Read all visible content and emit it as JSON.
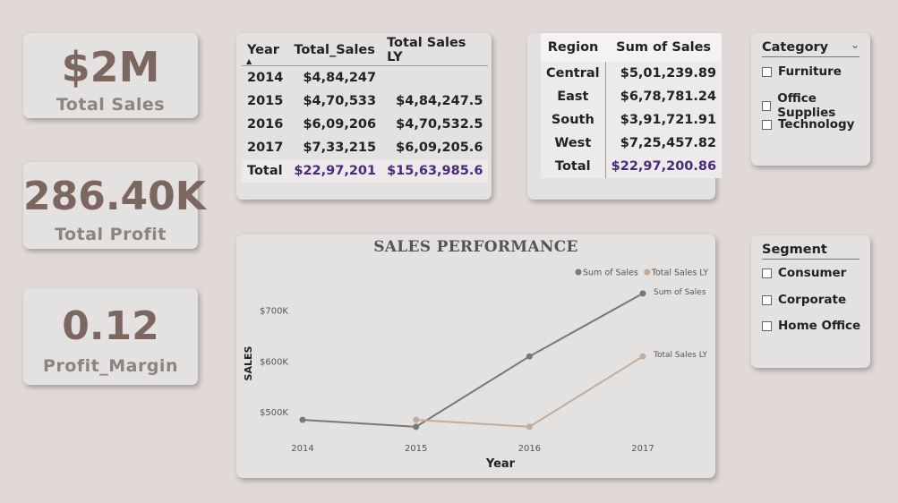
{
  "kpis": {
    "total_sales": {
      "value": "$2M",
      "label": "Total  Sales"
    },
    "total_profit": {
      "value": "286.40K",
      "label": "Total  Profit"
    },
    "profit_margin": {
      "value": "0.12",
      "label": "Profit_Margin"
    }
  },
  "year_table": {
    "headers": [
      "Year",
      "Total_Sales",
      "Total Sales LY"
    ],
    "rows": [
      [
        "2014",
        "$4,84,247",
        ""
      ],
      [
        "2015",
        "$4,70,533",
        "$4,84,247.5"
      ],
      [
        "2016",
        "$6,09,206",
        "$4,70,532.5"
      ],
      [
        "2017",
        "$7,33,215",
        "$6,09,205.6"
      ]
    ],
    "total": [
      "Total",
      "$22,97,201",
      "$15,63,985.6"
    ]
  },
  "region_table": {
    "headers": [
      "Region",
      "Sum of Sales"
    ],
    "rows": [
      [
        "Central",
        "$5,01,239.89"
      ],
      [
        "East",
        "$6,78,781.24"
      ],
      [
        "South",
        "$3,91,721.91"
      ],
      [
        "West",
        "$7,25,457.82"
      ]
    ],
    "total": [
      "Total",
      "$22,97,200.86"
    ]
  },
  "category_slicer": {
    "title": "Category",
    "items": [
      "Furniture",
      "Office Supplies",
      "Technology"
    ]
  },
  "segment_slicer": {
    "title": "Segment",
    "items": [
      "Consumer",
      "Corporate",
      "Home Office"
    ]
  },
  "chart_data": {
    "type": "line",
    "title": "SALES PERFORMANCE",
    "xlabel": "Year",
    "ylabel": "SALES",
    "x": [
      "2014",
      "2015",
      "2016",
      "2017"
    ],
    "ytick_labels": [
      "$500K",
      "$600K",
      "$700K"
    ],
    "yticks": [
      500000,
      600000,
      700000
    ],
    "ylim": [
      435000,
      770000
    ],
    "legend_position": "top-right",
    "series": [
      {
        "name": "Sum of Sales",
        "color": "#7a7777",
        "values": [
          484247,
          470533,
          609206,
          733215
        ]
      },
      {
        "name": "Total Sales LY",
        "color": "#c6ac97",
        "values": [
          null,
          484247.5,
          470532.5,
          609205.6
        ]
      }
    ]
  }
}
